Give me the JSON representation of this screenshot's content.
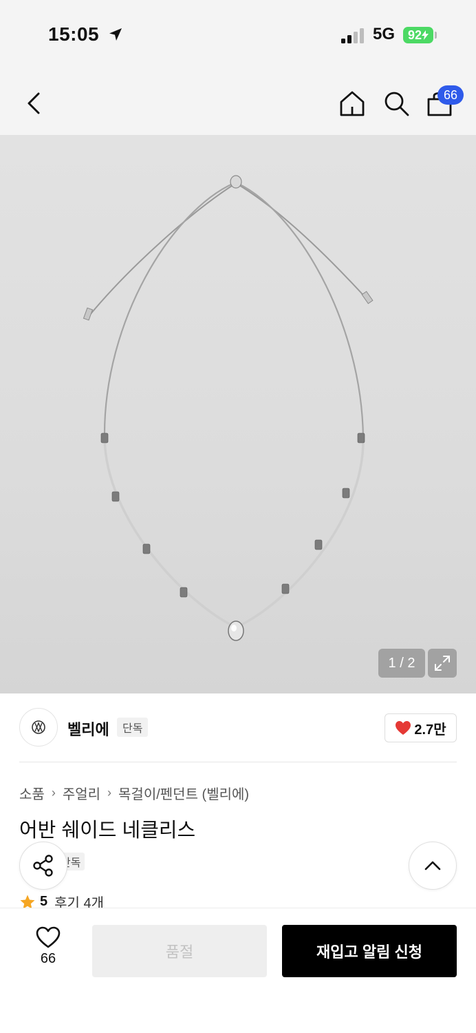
{
  "status_bar": {
    "time": "15:05",
    "network": "5G",
    "battery": "92",
    "icons": [
      "location-arrow-icon",
      "signal-icon",
      "battery-charging-icon"
    ]
  },
  "header": {
    "cart_count": "66",
    "icons": [
      "back-icon",
      "home-icon",
      "search-icon",
      "shopping-bag-icon"
    ]
  },
  "gallery": {
    "counter": "1 / 2",
    "icons": [
      "expand-icon"
    ]
  },
  "brand": {
    "name": "벨리에",
    "tag": "단독",
    "likes": "2.7만",
    "icons": [
      "brand-logo-icon",
      "heart-filled-icon"
    ]
  },
  "breadcrumb": [
    "소품",
    "주얼리",
    "목걸이/펜던트 (벨리에)"
  ],
  "product": {
    "title": "어반 쉐이드 네클리스",
    "tag": "단독",
    "rating": "5",
    "reviews": "후기 4개"
  },
  "floating": {
    "icons": [
      "share-icon",
      "chevron-up-icon"
    ]
  },
  "bottom_bar": {
    "wish_count": "66",
    "soldout_label": "품절",
    "restock_label": "재입고 알림 신청",
    "icons": [
      "heart-outline-icon"
    ]
  },
  "colors": {
    "accent_badge": "#2f5bea",
    "battery": "#4cd964",
    "heart": "#e53935",
    "star": "#f5a623",
    "primary_button": "#000000",
    "disabled_button": "#eeeeee"
  }
}
